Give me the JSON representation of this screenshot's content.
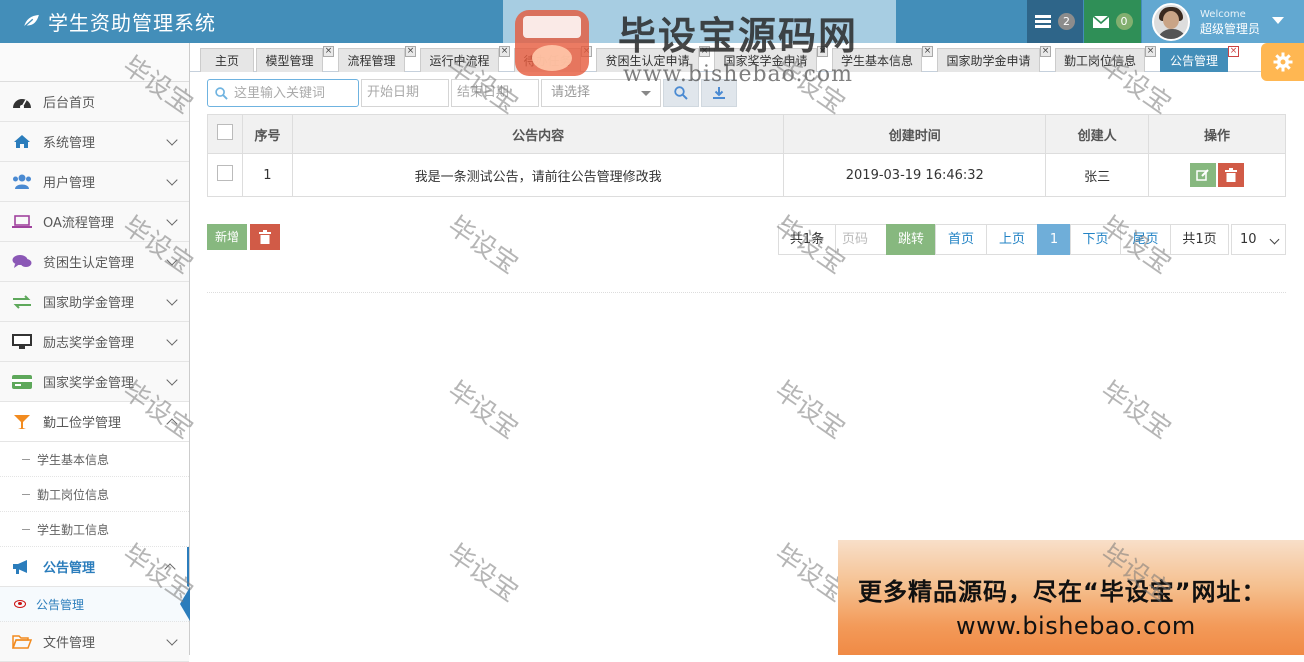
{
  "app": {
    "title": "学生资助管理系统"
  },
  "header": {
    "tasks_count": "2",
    "mail_count": "0",
    "welcome": "Welcome",
    "username": "超级管理员"
  },
  "sidebar": {
    "items": [
      {
        "label": "后台首页",
        "icon": "dashboard-icon"
      },
      {
        "label": "系统管理",
        "icon": "home-icon"
      },
      {
        "label": "用户管理",
        "icon": "users-icon"
      },
      {
        "label": "OA流程管理",
        "icon": "laptop-icon"
      },
      {
        "label": "贫困生认定管理",
        "icon": "comments-icon"
      },
      {
        "label": "国家助学金管理",
        "icon": "exchange-icon"
      },
      {
        "label": "励志奖学金管理",
        "icon": "desktop-icon"
      },
      {
        "label": "国家奖学金管理",
        "icon": "credit-card-icon"
      },
      {
        "label": "勤工俭学管理",
        "icon": "glass-icon"
      }
    ],
    "work_study_children": [
      "学生基本信息",
      "勤工岗位信息",
      "学生勤工信息"
    ],
    "notice_group": {
      "label": "公告管理",
      "icon": "bullhorn-icon"
    },
    "notice_child": "公告管理",
    "file_group": {
      "label": "文件管理",
      "icon": "folder-open-icon"
    }
  },
  "tabs": [
    "主页",
    "模型管理",
    "流程管理",
    "运行中流程",
    "待办任务",
    "贫困生认定申请",
    "国家奖学金申请",
    "学生基本信息",
    "国家助学金申请",
    "勤工岗位信息",
    "公告管理"
  ],
  "search": {
    "keyword_placeholder": "这里输入关键词",
    "start_placeholder": "开始日期",
    "end_placeholder": "结束日期",
    "select_placeholder": "请选择"
  },
  "table": {
    "headers": [
      "序号",
      "公告内容",
      "创建时间",
      "创建人",
      "操作"
    ],
    "rows": [
      {
        "no": "1",
        "content": "我是一条测试公告，请前往公告管理修改我",
        "created": "2019-03-19 16:46:32",
        "creator": "张三"
      }
    ]
  },
  "actions": {
    "add_label": "新增"
  },
  "pager": {
    "total": "共1条",
    "page_placeholder": "页码",
    "go": "跳转",
    "first": "首页",
    "prev": "上页",
    "current": "1",
    "next": "下页",
    "last": "尾页",
    "pages": "共1页",
    "page_size": "10"
  },
  "watermarks": {
    "text": "毕设宝",
    "logo_badge": "毕设宝",
    "logo_title": "毕设宝源码网",
    "logo_url": "www.bishebao.com",
    "promo_line1": "更多精品源码，尽在“毕设宝”网址：",
    "promo_line2": "www.bishebao.com"
  },
  "colors": {
    "navbar": "#438eb9",
    "accent": "#2b7dbc",
    "success": "#87b87f",
    "danger": "#d15b47",
    "warning": "#ffb752"
  }
}
